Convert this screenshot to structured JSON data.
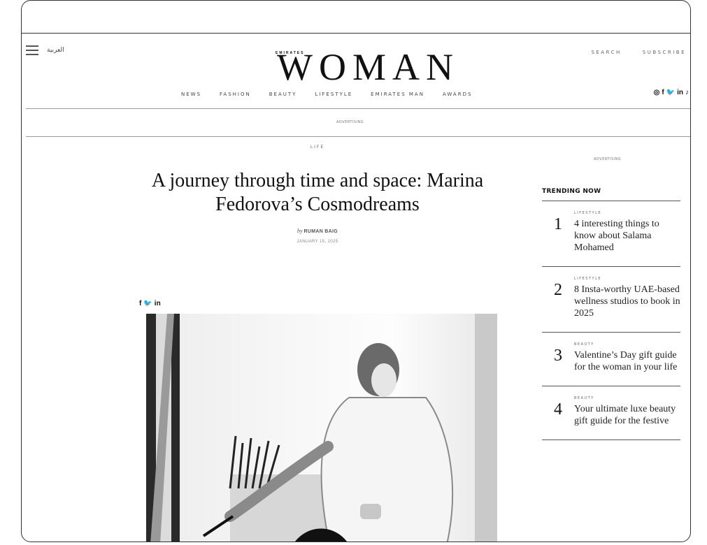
{
  "header": {
    "menu_icon": "hamburger-icon",
    "language": "العربية",
    "brand_kicker": "EMIRATES",
    "brand_name": "WOMAN",
    "search": "SEARCH",
    "subscribe": "SUBSCRIBE",
    "nav": [
      "NEWS",
      "FASHION",
      "BEAUTY",
      "LIFESTYLE",
      "EMIRATES MAN",
      "AWARDS"
    ],
    "social_icons": [
      "instagram-icon",
      "facebook-icon",
      "twitter-icon",
      "linkedin-icon",
      "tiktok-icon"
    ],
    "social_glyphs": [
      "◎",
      "f",
      "🐦",
      "in",
      "♪"
    ]
  },
  "ads": {
    "top": "ADVERTISING",
    "sidebar": "ADVERTISING"
  },
  "article": {
    "section": "LIFE",
    "title": "A journey through time and space: Marina Fedorova’s Cosmodreams",
    "by": "by",
    "author": "RUMAN BAIG",
    "date": "JANUARY 15, 2025",
    "share_icons": [
      "facebook-icon",
      "twitter-icon",
      "linkedin-icon"
    ],
    "share_glyphs": [
      "f",
      "🐦",
      "in"
    ]
  },
  "sidebar": {
    "trending_title": "TRENDING NOW",
    "items": [
      {
        "num": "1",
        "category": "LIFESTYLE",
        "title": "4 interesting things to know about Salama Mohamed"
      },
      {
        "num": "2",
        "category": "LIFESTYLE",
        "title": "8 Insta-worthy UAE-based wellness studios to book in 2025"
      },
      {
        "num": "3",
        "category": "BEAUTY",
        "title": "Valentine’s Day gift guide for the woman in your life"
      },
      {
        "num": "4",
        "category": "BEAUTY",
        "title": "Your ultimate luxe beauty gift guide for the festive"
      }
    ]
  }
}
